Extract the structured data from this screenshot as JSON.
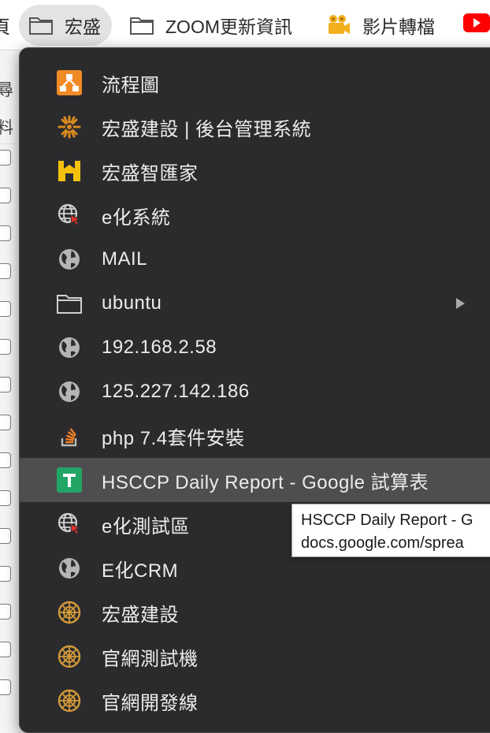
{
  "bookmarks_bar": {
    "partial_left_label": "頁",
    "items": [
      {
        "label": "宏盛",
        "icon": "folder-icon",
        "active": true
      },
      {
        "label": "ZOOM更新資訊",
        "icon": "folder-icon"
      },
      {
        "label": "影片轉檔",
        "icon": "film-camera-icon"
      }
    ],
    "clipped_right_icon": "youtube-icon"
  },
  "background_page": {
    "partial_text_1": "尋",
    "partial_text_2": "料"
  },
  "menu": {
    "items": [
      {
        "label": "流程圖",
        "icon": "flowchart-icon"
      },
      {
        "label": "宏盛建設 | 後台管理系統",
        "icon": "sunburst-logo-icon"
      },
      {
        "label": "宏盛智匯家",
        "icon": "h-logo-icon"
      },
      {
        "label": "e化系統",
        "icon": "globe-cursor-icon"
      },
      {
        "label": "MAIL",
        "icon": "globe-icon"
      },
      {
        "label": "ubuntu",
        "icon": "folder-icon",
        "has_submenu": true
      },
      {
        "label": "192.168.2.58",
        "icon": "globe-icon"
      },
      {
        "label": "125.227.142.186",
        "icon": "globe-icon"
      },
      {
        "label": "php 7.4套件安裝",
        "icon": "stackoverflow-icon"
      },
      {
        "label": "HSCCP Daily Report - Google 試算表",
        "icon": "google-sheets-icon",
        "hovered": true
      },
      {
        "label": "e化測試區",
        "icon": "globe-cursor-icon"
      },
      {
        "label": "E化CRM",
        "icon": "globe-icon"
      },
      {
        "label": "宏盛建設",
        "icon": "ornament-logo-icon"
      },
      {
        "label": "官網測試機",
        "icon": "ornament-logo-icon"
      },
      {
        "label": "官網開發線",
        "icon": "ornament-logo-icon"
      }
    ]
  },
  "tooltip": {
    "line1": "HSCCP Daily Report - G",
    "line2": "docs.google.com/sprea"
  },
  "colors": {
    "menu_bg": "#2b2b2d",
    "hover_bg": "#4e4e50",
    "flowchart_orange": "#f08a24",
    "sheets_green": "#23a566",
    "h_logo_yellow": "#f4c20d",
    "youtube_red": "#ff0000",
    "cursor_red": "#e0312b"
  }
}
